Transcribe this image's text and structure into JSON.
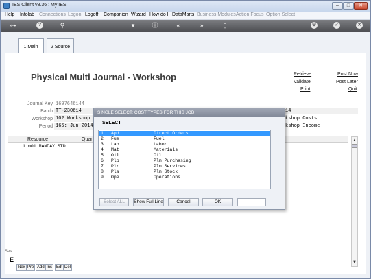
{
  "window": {
    "title": "IES Client v8.36 : My IES",
    "controls": [
      "–",
      "□",
      "✕"
    ]
  },
  "menubar": {
    "items": [
      {
        "label": "Help",
        "enabled": true
      },
      {
        "label": "Infolab",
        "enabled": true
      },
      {
        "label": "Connections",
        "enabled": false
      },
      {
        "label": "Logon",
        "enabled": false
      },
      {
        "label": "Logoff",
        "enabled": true
      },
      {
        "label": "Companion",
        "enabled": true
      },
      {
        "label": "Wizard",
        "enabled": true
      },
      {
        "label": "How do I",
        "enabled": true
      },
      {
        "label": "DataMarts",
        "enabled": true
      },
      {
        "label": "Business Modules",
        "enabled": false
      },
      {
        "label": "Action Focus",
        "enabled": false
      },
      {
        "label": "Option Select",
        "enabled": false
      }
    ]
  },
  "toolbar": {
    "icons": [
      "key-icon",
      "help-icon",
      "search-icon",
      "heart-icon",
      "info-icon",
      "rewind-icon",
      "fast-forward-icon",
      "bar-icon",
      "settings-icon",
      "check-icon",
      "close-icon"
    ]
  },
  "tabs": [
    {
      "label": "1 Main"
    },
    {
      "label": "2 Source"
    }
  ],
  "page": {
    "title": "Physical Multi Journal - Workshop",
    "links_left": [
      "Retrieve",
      "Validate",
      "Print"
    ],
    "links_right": [
      "Post Now",
      "Post Later",
      "Quit"
    ]
  },
  "fields": {
    "journal_key": {
      "label": "Journal Key",
      "value": "1697646144"
    },
    "batch": {
      "label": "Batch",
      "value": "TT-230614"
    },
    "workshop": {
      "label": "Workshop",
      "value": "102 Workshop 10"
    },
    "period": {
      "label": "Period",
      "value": "165: Jun 2014"
    },
    "right_row1": "14",
    "right_row2": "kshop Costs",
    "right_row3": "kshop Income"
  },
  "grid": {
    "headers": [
      "Resource",
      "Quant"
    ],
    "rows": [
      {
        "num": "1",
        "text": "m01 MANDAY STD"
      }
    ]
  },
  "left_label": "Ses",
  "bottom_tabs": [
    "Nex",
    "Pre",
    "Add",
    "Ins",
    "Edt",
    "Del"
  ],
  "bottom_left_letter": "E",
  "modal": {
    "title": "SINGLE SELECT: COST TYPES FOR THIS JOB",
    "heading": "SELECT",
    "rows": [
      {
        "num": "1",
        "code": "Apd",
        "desc": "Direct Orders",
        "selected": true
      },
      {
        "num": "2",
        "code": "Fue",
        "desc": "Fuel",
        "selected": false
      },
      {
        "num": "3",
        "code": "Lab",
        "desc": "Labor",
        "selected": false
      },
      {
        "num": "4",
        "code": "Mat",
        "desc": "Materials",
        "selected": false
      },
      {
        "num": "5",
        "code": "Oil",
        "desc": "Oil",
        "selected": false
      },
      {
        "num": "6",
        "code": "Plp",
        "desc": "Plm Purchasing",
        "selected": false
      },
      {
        "num": "7",
        "code": "Plr",
        "desc": "Plm Services",
        "selected": false
      },
      {
        "num": "8",
        "code": "Pls",
        "desc": "Plm Stock",
        "selected": false
      },
      {
        "num": "9",
        "code": "Ope",
        "desc": "Operations",
        "selected": false
      }
    ],
    "buttons": {
      "select_all": "Select ALL",
      "show_full_line": "Show Full Line",
      "cancel": "Cancel",
      "ok": "OK",
      "extra": ""
    }
  },
  "colors": {
    "selection": "#3399ff",
    "toolbar": "#5f6064",
    "modal_title": "#8a92a2"
  }
}
